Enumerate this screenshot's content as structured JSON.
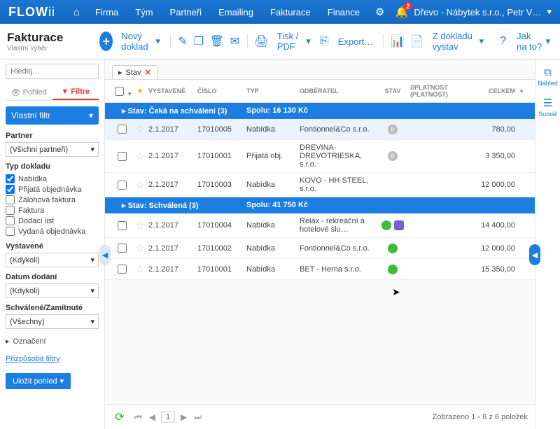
{
  "top": {
    "logo1": "FLOW",
    "logo2": "ii",
    "nav": [
      "Firma",
      "Tým",
      "Partneři",
      "Emailing",
      "Fakturace",
      "Finance"
    ],
    "notif_count": "2",
    "company": "Dřevo - Nábytek s.r.o., Petr V…"
  },
  "sub": {
    "title": "Fakturace",
    "subtitle": "Vlastní výběr",
    "new_doc": "Nový doklad",
    "print": "Tisk / PDF",
    "export": "Export…",
    "zdokladu": "Z dokladu vystav",
    "jak": "Jak na to?"
  },
  "side": {
    "search_ph": "Hledej…",
    "tab_pohled": "Pohled",
    "tab_filtre": "Filtre",
    "vlastni": "Vlastní filtr",
    "partner_lbl": "Partner",
    "partner_val": "(Všichni partneři)",
    "typ_lbl": "Typ dokladu",
    "typ_items": [
      {
        "l": "Nabídka",
        "c": true
      },
      {
        "l": "Přijatá objednávka",
        "c": true
      },
      {
        "l": "Zálohová faktura",
        "c": false
      },
      {
        "l": "Faktura",
        "c": false
      },
      {
        "l": "Dodací list",
        "c": false
      },
      {
        "l": "Vydaná objednávka",
        "c": false
      }
    ],
    "vyst_lbl": "Vystavené",
    "vyst_val": "(Kdykoli)",
    "datum_lbl": "Datum dodání",
    "datum_val": "(Kdykoli)",
    "sch_lbl": "Schválené/Zamítnuté",
    "sch_val": "(Všechny)",
    "ozn": "Označení",
    "priz": "Přizpůsobit filtry",
    "save": "Uložit pohled"
  },
  "grid": {
    "tag": "Stav",
    "cols": {
      "vyst": "VYSTAVENÉ",
      "cislo": "ČÍSLO",
      "typ": "TYP",
      "odb": "ODBĚRATEL",
      "stav": "STAV",
      "spl1": "SPLATNOST",
      "spl2": "(PLATNOST)",
      "celk": "CELKEM"
    },
    "g1": {
      "label": "Stav: Čeká na schválení (3)",
      "sum": "Spolu: 16 130 Kč"
    },
    "g1_rows": [
      {
        "d": "2.1.2017",
        "n": "17010005",
        "t": "Nabídka",
        "o": "Fontionnel&Co s.r.o.",
        "s": "grey",
        "c": "780,00",
        "sel": true
      },
      {
        "d": "2.1.2017",
        "n": "17010001",
        "t": "Přijatá obj.",
        "o": "DREVINA-DREVOTRIESKA, s.r.o.",
        "s": "grey",
        "c": "3 350,00"
      },
      {
        "d": "2.1.2017",
        "n": "17010003",
        "t": "Nabídka",
        "o": "KOVO - HH STEEL, s.r.o.",
        "s": "",
        "c": "12 000,00"
      }
    ],
    "g2": {
      "label": "Stav: Schválená (3)",
      "sum": "Spolu: 41 750 Kč"
    },
    "g2_rows": [
      {
        "d": "2.1.2017",
        "n": "17010004",
        "t": "Nabídka",
        "o": "Relax - rekreační a hotelové slu…",
        "s": "green",
        "extra": true,
        "c": "14 400,00"
      },
      {
        "d": "2.1.2017",
        "n": "17010002",
        "t": "Nabídka",
        "o": "Fontionnel&Co s.r.o.",
        "s": "green",
        "c": "12 000,00"
      },
      {
        "d": "2.1.2017",
        "n": "17010001",
        "t": "Nabídka",
        "o": "BET - Herna s.r.o.",
        "s": "green",
        "c": "15 350,00"
      }
    ],
    "footer": "Zobrazeno 1 - 6 z 6 položek",
    "page": "1"
  },
  "rside": {
    "nahled": "Náhled",
    "sumar": "Sumář"
  }
}
